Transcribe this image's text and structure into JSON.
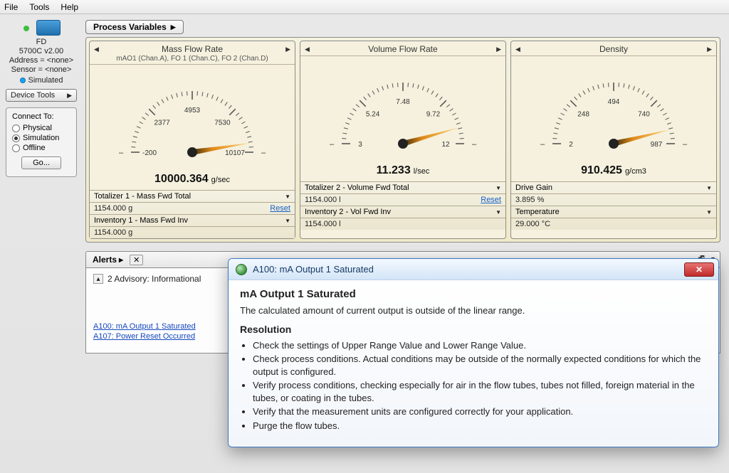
{
  "menu": {
    "file": "File",
    "tools": "Tools",
    "help": "Help"
  },
  "device": {
    "name": "FD",
    "model": "5700C  v2.00",
    "address": "Address = <none>",
    "sensor": "Sensor = <none>",
    "sim_label": "Simulated",
    "tools_btn": "Device Tools"
  },
  "connect": {
    "title": "Connect To:",
    "opt_physical": "Physical",
    "opt_simulation": "Simulation",
    "opt_offline": "Offline",
    "go": "Go..."
  },
  "section_tab": "Process Variables",
  "gauges": [
    {
      "title": "Mass Flow Rate",
      "sub": "mAO1 (Chan.A), FO 1 (Chan.C), FO 2 (Chan.D)",
      "min": "-200",
      "t1": "2377",
      "t2": "4953",
      "t3": "7530",
      "max": "10107",
      "value": "10000.364",
      "unit": "g/sec",
      "needle_angle": 81,
      "drop1": "Totalizer 1 - Mass Fwd Total",
      "val1": "1154.000 g",
      "reset1": "Reset",
      "drop2": "Inventory 1 - Mass Fwd Inv",
      "val2": "1154.000 g"
    },
    {
      "title": "Volume Flow Rate",
      "sub": "",
      "min": "3",
      "t1": "5.24",
      "t2": "7.48",
      "t3": "9.72",
      "max": "12",
      "value": "11.233",
      "unit": "l/sec",
      "needle_angle": 74,
      "drop1": "Totalizer 2 - Volume Fwd Total",
      "val1": "1154.000 l",
      "reset1": "Reset",
      "drop2": "Inventory 2 - Vol Fwd Inv",
      "val2": "1154.000 l"
    },
    {
      "title": "Density",
      "sub": "",
      "min": "2",
      "t1": "248",
      "t2": "494",
      "t3": "740",
      "max": "987",
      "value": "910.425",
      "unit": "g/cm3",
      "needle_angle": 76,
      "drop1": "Drive Gain",
      "val1": "3.895 %",
      "reset1": "",
      "drop2": "Temperature",
      "val2": "29.000 °C"
    }
  ],
  "alerts": {
    "tab": "Alerts",
    "header": "2 Advisory: Informational",
    "links": [
      "A100: mA Output 1 Saturated",
      "A107: Power Reset Occurred"
    ]
  },
  "popup": {
    "title": "A100: mA Output 1 Saturated",
    "h": "mA Output 1 Saturated",
    "desc": "The calculated amount of current output is outside of the linear range.",
    "res_h": "Resolution",
    "bullets": [
      "Check the settings of Upper Range Value and Lower Range Value.",
      "Check process conditions. Actual conditions may be outside of the normally expected conditions for which the output is configured.",
      "Verify process conditions, checking especially for air in the flow tubes, tubes not filled, foreign material in the tubes, or coating in the tubes.",
      "Verify that the measurement units are configured correctly for your application.",
      "Purge the flow tubes."
    ]
  },
  "chart_data": [
    {
      "type": "gauge",
      "title": "Mass Flow Rate",
      "min": -200,
      "max": 10107,
      "ticks": [
        -200,
        2377,
        4953,
        7530,
        10107
      ],
      "value": 10000.364,
      "unit": "g/sec"
    },
    {
      "type": "gauge",
      "title": "Volume Flow Rate",
      "min": 3,
      "max": 12,
      "ticks": [
        3,
        5.24,
        7.48,
        9.72,
        12
      ],
      "value": 11.233,
      "unit": "l/sec"
    },
    {
      "type": "gauge",
      "title": "Density",
      "min": 2,
      "max": 987,
      "ticks": [
        2,
        248,
        494,
        740,
        987
      ],
      "value": 910.425,
      "unit": "g/cm3"
    }
  ]
}
